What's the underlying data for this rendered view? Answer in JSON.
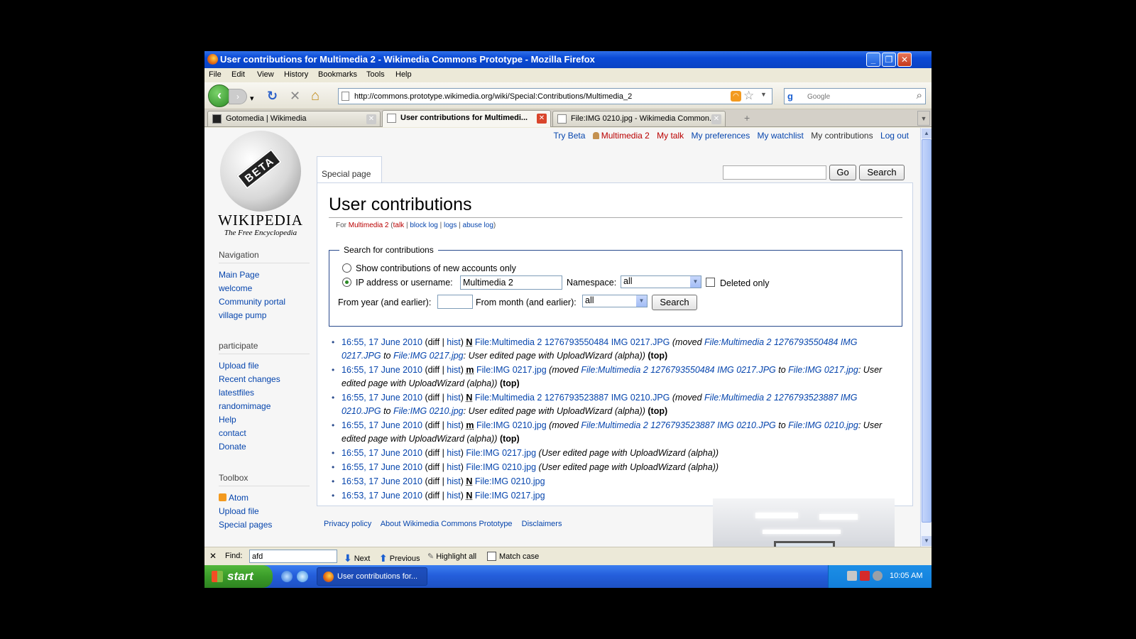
{
  "window": {
    "title": "User contributions for Multimedia 2 - Wikimedia Commons Prototype - Mozilla Firefox",
    "controls": {
      "minimize": "_",
      "maximize": "❐",
      "close": "✕"
    }
  },
  "menu": [
    "File",
    "Edit",
    "View",
    "History",
    "Bookmarks",
    "Tools",
    "Help"
  ],
  "toolbar": {
    "back": "‹",
    "forward": "›",
    "dropdown": "▾",
    "reload": "↻",
    "stop": "✕",
    "home": "⌂",
    "url": "http://commons.prototype.wikimedia.org/wiki/Special:Contributions/Multimedia_2",
    "search_placeholder": "Google"
  },
  "tabs": [
    {
      "label": "Gotomedia | Wikimedia",
      "active": false
    },
    {
      "label": "User contributions for Multimedi...",
      "active": true
    },
    {
      "label": "File:IMG 0210.jpg - Wikimedia Common...",
      "active": false
    }
  ],
  "logo": {
    "badge": "BETA",
    "wordmark": "WIKIPEDIA",
    "tagline": "The Free Encyclopedia"
  },
  "personal_tools": {
    "try_beta": "Try Beta",
    "user": "Multimedia 2",
    "my_talk": "My talk",
    "my_preferences": "My preferences",
    "my_watchlist": "My watchlist",
    "my_contributions": "My contributions",
    "log_out": "Log out"
  },
  "sidebar": {
    "navigation": {
      "heading": "Navigation",
      "items": [
        "Main Page",
        "welcome",
        "Community portal",
        "village pump"
      ]
    },
    "participate": {
      "heading": "participate",
      "items": [
        "Upload file",
        "Recent changes",
        "latestfiles",
        "randomimage",
        "Help",
        "contact",
        "Donate"
      ]
    },
    "toolbox": {
      "heading": "Toolbox",
      "items": [
        "Atom",
        "Upload file",
        "Special pages"
      ]
    }
  },
  "page": {
    "tab_label": "Special page",
    "go_button": "Go",
    "search_button": "Search",
    "title": "User contributions",
    "subtitle": {
      "for": "For",
      "user": "Multimedia 2",
      "open": "(",
      "talk": "talk",
      "block_log": "block log",
      "logs": "logs",
      "abuse_log": "abuse log",
      "sep": "|",
      "close": ")"
    }
  },
  "search_form": {
    "legend": "Search for contributions",
    "option_new_accounts": "Show contributions of new accounts only",
    "option_ip_user": "IP address or username:",
    "username_value": "Multimedia 2",
    "namespace_label": "Namespace:",
    "namespace_value": "all",
    "deleted_only": "Deleted only",
    "from_year_label": "From year (and earlier):",
    "from_year_value": "",
    "from_month_label": "From month (and earlier):",
    "from_month_value": "all",
    "search_button": "Search"
  },
  "contributions": [
    {
      "time": "16:55, 17 June 2010",
      "diff": "diff",
      "hist": "hist",
      "flag": "N",
      "page": "File:Multimedia 2 1276793550484 IMG 0217.JPG",
      "summary_a": "(moved ",
      "summary_link1": "File:Multimedia 2 1276793550484 IMG 0217.JPG",
      "summary_to": " to ",
      "summary_link2": "File:IMG 0217.jpg",
      "summary_b": ": User edited page with UploadWizard (alpha))",
      "top": "(top)"
    },
    {
      "time": "16:55, 17 June 2010",
      "diff": "diff",
      "hist": "hist",
      "flag": "m",
      "page": "File:IMG 0217.jpg",
      "summary_a": "(moved ",
      "summary_link1": "File:Multimedia 2 1276793550484 IMG 0217.JPG",
      "summary_to": " to ",
      "summary_link2": "File:IMG 0217.jpg",
      "summary_b": ": User edited page with UploadWizard (alpha))",
      "top": "(top)"
    },
    {
      "time": "16:55, 17 June 2010",
      "diff": "diff",
      "hist": "hist",
      "flag": "N",
      "page": "File:Multimedia 2 1276793523887 IMG 0210.JPG",
      "summary_a": "(moved ",
      "summary_link1": "File:Multimedia 2 1276793523887 IMG 0210.JPG",
      "summary_to": " to ",
      "summary_link2": "File:IMG 0210.jpg",
      "summary_b": ": User edited page with UploadWizard (alpha))",
      "top": "(top)"
    },
    {
      "time": "16:55, 17 June 2010",
      "diff": "diff",
      "hist": "hist",
      "flag": "m",
      "page": "File:IMG 0210.jpg",
      "summary_a": "(moved ",
      "summary_link1": "File:Multimedia 2 1276793523887 IMG 0210.JPG",
      "summary_to": " to ",
      "summary_link2": "File:IMG 0210.jpg",
      "summary_b": ": User edited page with UploadWizard (alpha))",
      "top": "(top)"
    },
    {
      "time": "16:55, 17 June 2010",
      "diff": "diff",
      "hist": "hist",
      "flag": "",
      "page": "File:IMG 0217.jpg",
      "summary_a": "(User edited page with UploadWizard (alpha))",
      "summary_link1": "",
      "summary_to": "",
      "summary_link2": "",
      "summary_b": "",
      "top": ""
    },
    {
      "time": "16:55, 17 June 2010",
      "diff": "diff",
      "hist": "hist",
      "flag": "",
      "page": "File:IMG 0210.jpg",
      "summary_a": "(User edited page with UploadWizard (alpha))",
      "summary_link1": "",
      "summary_to": "",
      "summary_link2": "",
      "summary_b": "",
      "top": ""
    },
    {
      "time": "16:53, 17 June 2010",
      "diff": "diff",
      "hist": "hist",
      "flag": "N",
      "page": "File:IMG 0210.jpg",
      "summary_a": "",
      "summary_link1": "",
      "summary_to": "",
      "summary_link2": "",
      "summary_b": "",
      "top": ""
    },
    {
      "time": "16:53, 17 June 2010",
      "diff": "diff",
      "hist": "hist",
      "flag": "N",
      "page": "File:IMG 0217.jpg",
      "summary_a": "",
      "summary_link1": "",
      "summary_to": "",
      "summary_link2": "",
      "summary_b": "",
      "top": ""
    }
  ],
  "footer": [
    "Privacy policy",
    "About Wikimedia Commons Prototype",
    "Disclaimers"
  ],
  "findbar": {
    "close": "✕",
    "label": "Find:",
    "value": "afd",
    "next": "Next",
    "previous": "Previous",
    "highlight_all": "Highlight all",
    "match_case": "Match case"
  },
  "taskbar": {
    "start": "start",
    "task_item": "User contributions for...",
    "clock": "10:05 AM"
  },
  "colors": {
    "link": "#0645ad",
    "user_link": "#ba0000",
    "titlebar": "#0a4ad6",
    "taskbar": "#245edb",
    "start": "#3a9b29"
  },
  "icons": [
    "firefox-icon",
    "back-arrow-icon",
    "forward-arrow-icon",
    "reload-icon",
    "stop-icon",
    "home-icon",
    "page-icon",
    "rss-icon",
    "star-icon",
    "google-icon",
    "magnifier-icon",
    "wikipedia-globe-logo",
    "user-icon",
    "atom-feed-icon",
    "windows-flag-icon"
  ]
}
